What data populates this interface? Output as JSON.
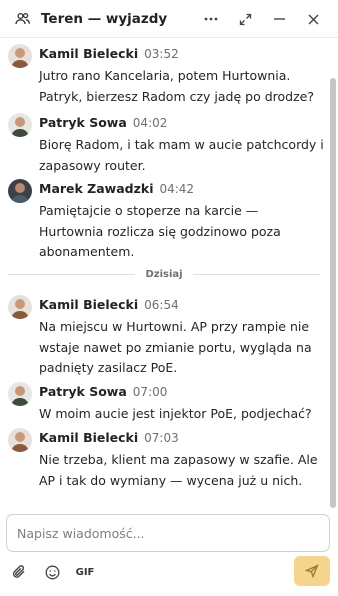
{
  "header": {
    "title": "Teren — wyjazdy",
    "icon": "people-icon",
    "actions": [
      "more-icon",
      "expand-icon",
      "minimize-icon",
      "close-icon"
    ]
  },
  "messages": [
    {
      "author": "Kamil Bielecki",
      "time": "03:52",
      "text": "Jutro rano Kancelaria, potem Hurtownia. Patryk, bierzesz Radom czy jadę po drodze?",
      "avatar_color": "#8a5a3c"
    },
    {
      "author": "Patryk Sowa",
      "time": "04:02",
      "text": "Biorę Radom, i tak mam w aucie patchcordy i zapasowy router.",
      "avatar_color": "#3f4a3a"
    },
    {
      "author": "Marek Zawadzki",
      "time": "04:42",
      "text": "Pamiętajcie o stoperze na karcie — Hurtownia rozlicza się godzinowo poza abonamentem.",
      "avatar_color": "#4a5a6a"
    },
    {
      "author": "Kamil Bielecki",
      "time": "06:54",
      "text": "Na miejscu w Hurtowni. AP przy rampie nie wstaje nawet po zmianie portu, wygląda na padnięty zasilacz PoE.",
      "avatar_color": "#8a5a3c"
    },
    {
      "author": "Patryk Sowa",
      "time": "07:00",
      "text": "W moim aucie jest injektor PoE, podjechać?",
      "avatar_color": "#3f4a3a"
    },
    {
      "author": "Kamil Bielecki",
      "time": "07:03",
      "text": "Nie trzeba, klient ma zapasowy w szafie. Ale AP i tak do wymiany — wycena już u nich.",
      "avatar_color": "#8a5a3c"
    }
  ],
  "divider": {
    "label": "Dzisiaj"
  },
  "composer": {
    "placeholder": "Napisz wiadomość...",
    "value": ""
  },
  "toolbar": {
    "gif_label": "GIF",
    "send_color": "#f4d58a"
  }
}
